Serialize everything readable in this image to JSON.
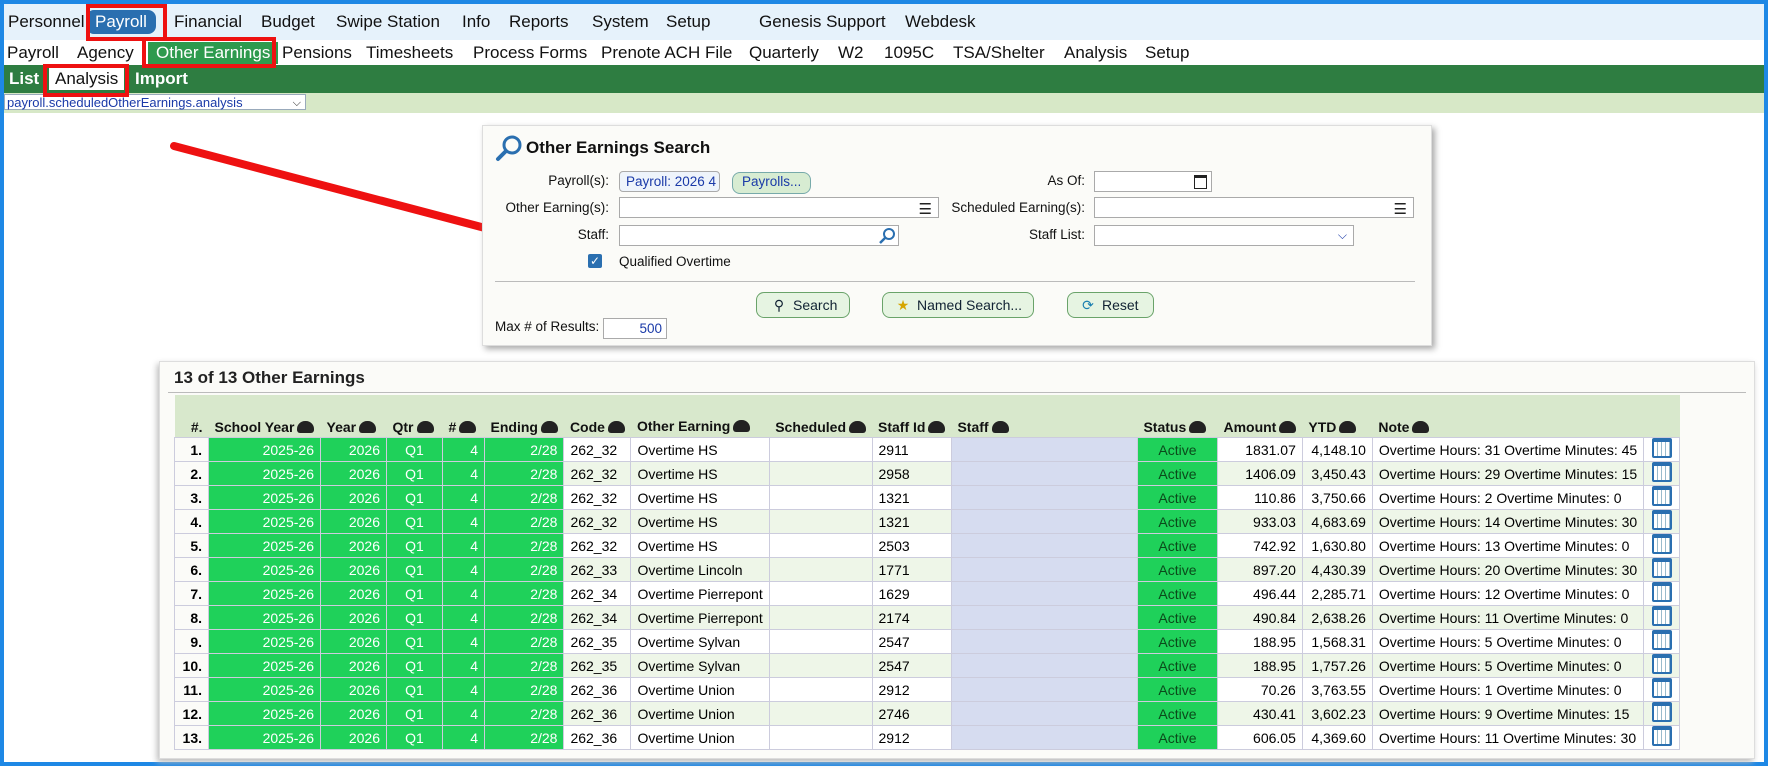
{
  "top_nav": [
    "Personnel",
    "Payroll",
    "Financial",
    "Budget",
    "Swipe Station",
    "Info",
    "Reports",
    "System",
    "Setup",
    "Genesis Support",
    "Webdesk"
  ],
  "sub_nav": [
    "Payroll",
    "Agency",
    "Other Earnings",
    "Pensions",
    "Timesheets",
    "Process Forms",
    "Prenote ACH File",
    "Quarterly",
    "W2",
    "1095C",
    "TSA/Shelter",
    "Analysis",
    "Setup"
  ],
  "third_nav": [
    "List",
    "Analysis",
    "Import"
  ],
  "path_select": "payroll.scheduledOtherEarnings.analysis",
  "search": {
    "title": "Other Earnings Search",
    "payrolls_label": "Payroll(s):",
    "payrolls_value": "Payroll: 2026 4",
    "payrolls_button": "Payrolls...",
    "as_of_label": "As Of:",
    "other_earnings_label": "Other Earning(s):",
    "scheduled_earnings_label": "Scheduled Earning(s):",
    "staff_label": "Staff:",
    "staff_list_label": "Staff List:",
    "qualified_overtime_label": "Qualified Overtime",
    "search_button": "Search",
    "named_search_button": "Named Search...",
    "reset_button": "Reset",
    "max_results_label": "Max # of Results:",
    "max_results_value": "500"
  },
  "results": {
    "title": "13 of 13 Other Earnings",
    "columns": [
      "#.",
      "School Year",
      "Year",
      "Qtr",
      "#",
      "Ending",
      "Code",
      "Other Earning",
      "Scheduled",
      "Staff Id",
      "Staff",
      "Status",
      "Amount",
      "YTD",
      "Note"
    ],
    "rows": [
      [
        "1.",
        "2025-26",
        "2026",
        "Q1",
        "4",
        "2/28",
        "262_32",
        "Overtime HS",
        "",
        "2911",
        "",
        "Active",
        "1831.07",
        "4,148.10",
        "Overtime Hours: 31 Overtime Minutes: 45"
      ],
      [
        "2.",
        "2025-26",
        "2026",
        "Q1",
        "4",
        "2/28",
        "262_32",
        "Overtime HS",
        "",
        "2958",
        "",
        "Active",
        "1406.09",
        "3,450.43",
        "Overtime Hours: 29 Overtime Minutes: 15"
      ],
      [
        "3.",
        "2025-26",
        "2026",
        "Q1",
        "4",
        "2/28",
        "262_32",
        "Overtime HS",
        "",
        "1321",
        "",
        "Active",
        "110.86",
        "3,750.66",
        "Overtime Hours: 2 Overtime Minutes: 0"
      ],
      [
        "4.",
        "2025-26",
        "2026",
        "Q1",
        "4",
        "2/28",
        "262_32",
        "Overtime HS",
        "",
        "1321",
        "",
        "Active",
        "933.03",
        "4,683.69",
        "Overtime Hours: 14 Overtime Minutes: 30"
      ],
      [
        "5.",
        "2025-26",
        "2026",
        "Q1",
        "4",
        "2/28",
        "262_32",
        "Overtime HS",
        "",
        "2503",
        "",
        "Active",
        "742.92",
        "1,630.80",
        "Overtime Hours: 13 Overtime Minutes: 0"
      ],
      [
        "6.",
        "2025-26",
        "2026",
        "Q1",
        "4",
        "2/28",
        "262_33",
        "Overtime Lincoln",
        "",
        "1771",
        "",
        "Active",
        "897.20",
        "4,430.39",
        "Overtime Hours: 20 Overtime Minutes: 30"
      ],
      [
        "7.",
        "2025-26",
        "2026",
        "Q1",
        "4",
        "2/28",
        "262_34",
        "Overtime Pierrepont",
        "",
        "1629",
        "",
        "Active",
        "496.44",
        "2,285.71",
        "Overtime Hours: 12 Overtime Minutes: 0"
      ],
      [
        "8.",
        "2025-26",
        "2026",
        "Q1",
        "4",
        "2/28",
        "262_34",
        "Overtime Pierrepont",
        "",
        "2174",
        "",
        "Active",
        "490.84",
        "2,638.26",
        "Overtime Hours: 11 Overtime Minutes: 0"
      ],
      [
        "9.",
        "2025-26",
        "2026",
        "Q1",
        "4",
        "2/28",
        "262_35",
        "Overtime Sylvan",
        "",
        "2547",
        "",
        "Active",
        "188.95",
        "1,568.31",
        "Overtime Hours: 5 Overtime Minutes: 0"
      ],
      [
        "10.",
        "2025-26",
        "2026",
        "Q1",
        "4",
        "2/28",
        "262_35",
        "Overtime Sylvan",
        "",
        "2547",
        "",
        "Active",
        "188.95",
        "1,757.26",
        "Overtime Hours: 5 Overtime Minutes: 0"
      ],
      [
        "11.",
        "2025-26",
        "2026",
        "Q1",
        "4",
        "2/28",
        "262_36",
        "Overtime Union",
        "",
        "2912",
        "",
        "Active",
        "70.26",
        "3,763.55",
        "Overtime Hours: 1 Overtime Minutes: 0"
      ],
      [
        "12.",
        "2025-26",
        "2026",
        "Q1",
        "4",
        "2/28",
        "262_36",
        "Overtime Union",
        "",
        "2746",
        "",
        "Active",
        "430.41",
        "3,602.23",
        "Overtime Hours: 9 Overtime Minutes: 15"
      ],
      [
        "13.",
        "2025-26",
        "2026",
        "Q1",
        "4",
        "2/28",
        "262_36",
        "Overtime Union",
        "",
        "2912",
        "",
        "Active",
        "606.05",
        "4,369.60",
        "Overtime Hours: 11 Overtime Minutes: 30"
      ]
    ]
  },
  "colors": {
    "accent_blue": "#2a6fb0",
    "nav_green": "#2e7d41",
    "active_green": "#1fd15a",
    "highlight_red": "#ee1111"
  }
}
